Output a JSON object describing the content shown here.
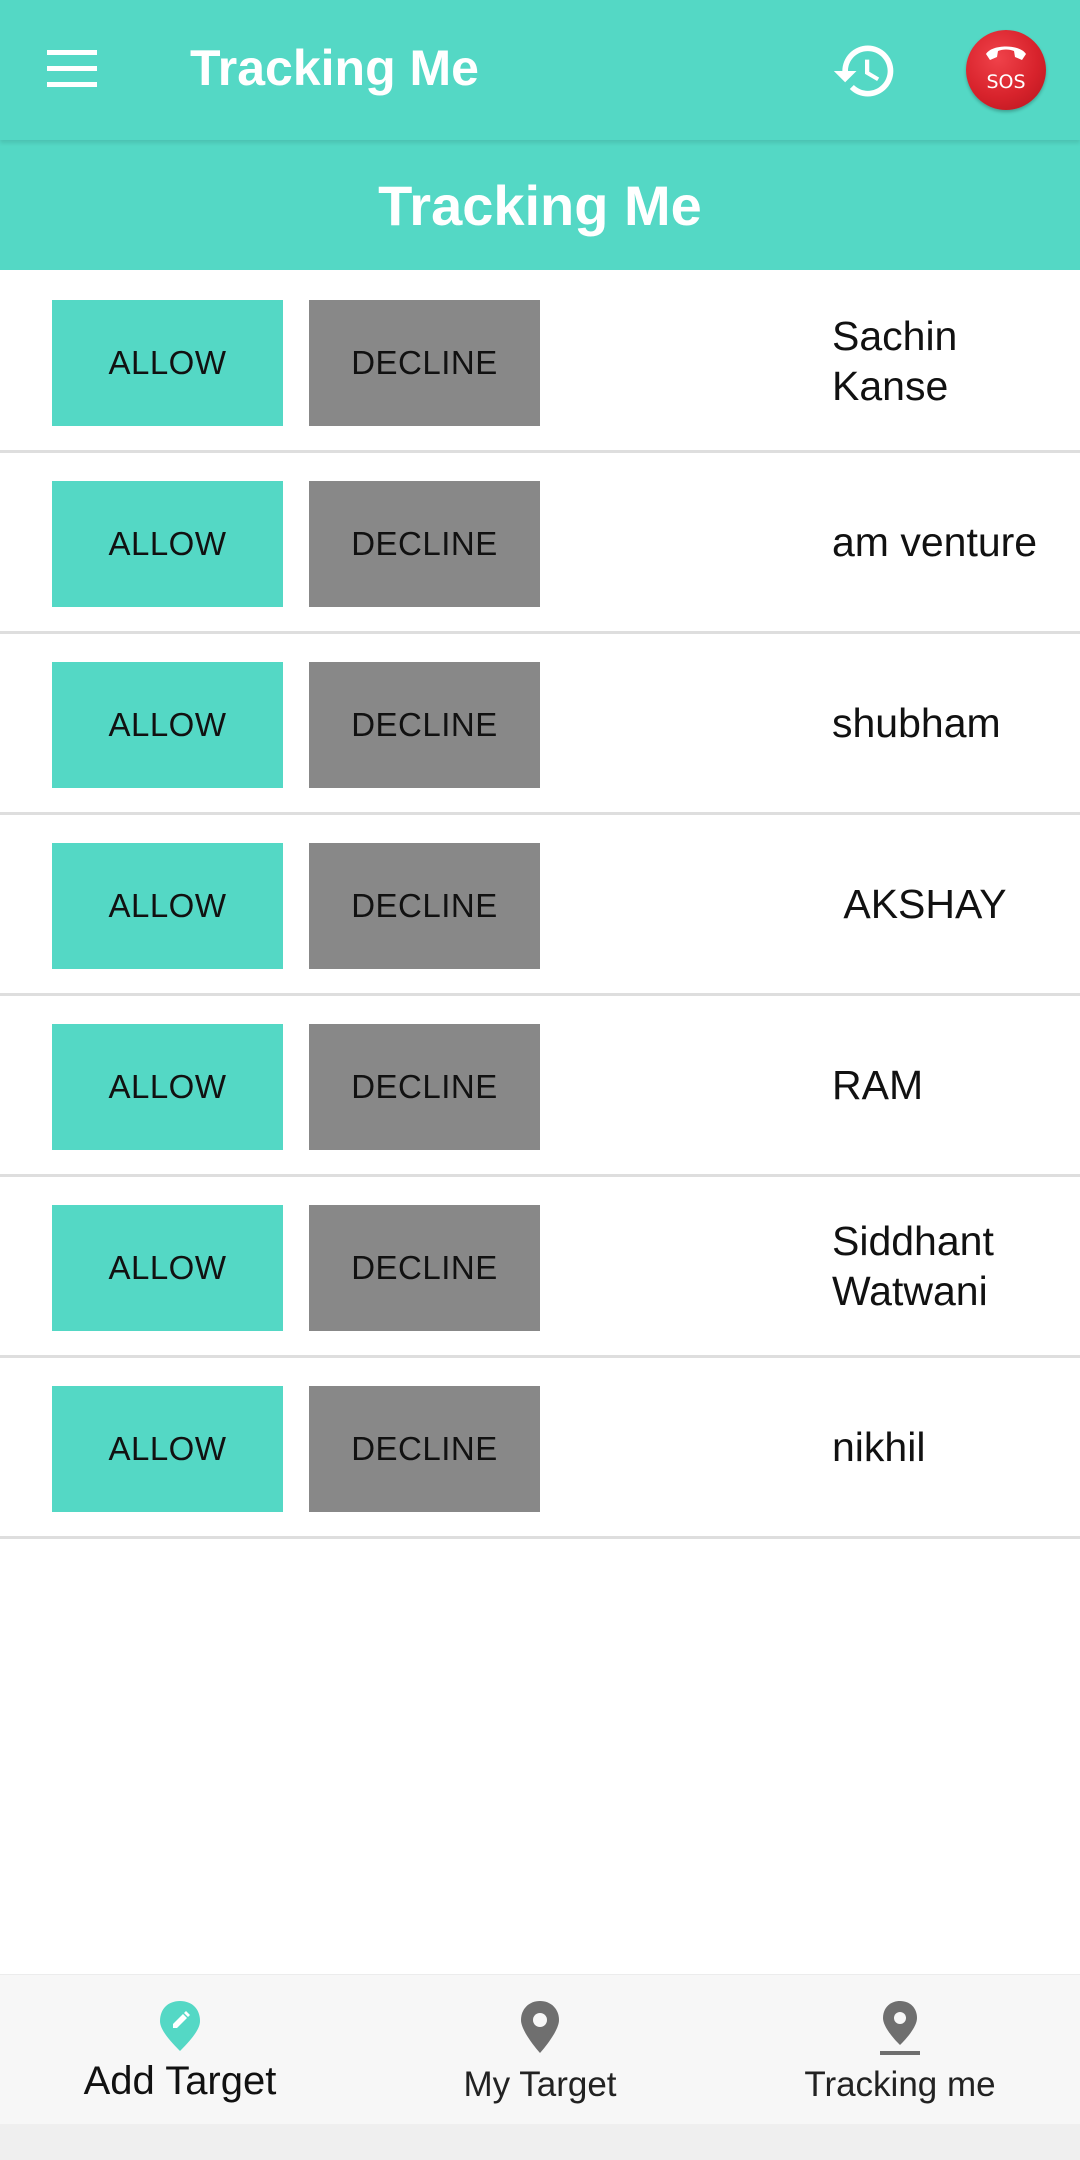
{
  "appbar": {
    "title": "Tracking Me",
    "menu_icon": "menu-icon",
    "history_icon": "history-icon",
    "sos_label": "SOS",
    "color": "#54d8c5"
  },
  "section": {
    "title": "Tracking Me"
  },
  "requests": [
    {
      "allow_label": "ALLOW",
      "decline_label": "DECLINE",
      "name": "Sachin Kanse"
    },
    {
      "allow_label": "ALLOW",
      "decline_label": "DECLINE",
      "name": "am venture"
    },
    {
      "allow_label": "ALLOW",
      "decline_label": "DECLINE",
      "name": "shubham"
    },
    {
      "allow_label": "ALLOW",
      "decline_label": "DECLINE",
      "name": "AKSHAY"
    },
    {
      "allow_label": "ALLOW",
      "decline_label": "DECLINE",
      "name": "RAM"
    },
    {
      "allow_label": "ALLOW",
      "decline_label": "DECLINE",
      "name": "Siddhant Watwani"
    },
    {
      "allow_label": "ALLOW",
      "decline_label": "DECLINE",
      "name": "nikhil"
    }
  ],
  "bottom_nav": {
    "items": [
      {
        "label": "Add Target",
        "icon": "edit-pin-icon",
        "active": true
      },
      {
        "label": "My Target",
        "icon": "location-pin-icon",
        "active": false
      },
      {
        "label": "Tracking me",
        "icon": "location-pin-icon",
        "active": false
      }
    ]
  },
  "colors": {
    "accent": "#54d8c5",
    "decline": "#888888",
    "sos": "#d8232c"
  }
}
